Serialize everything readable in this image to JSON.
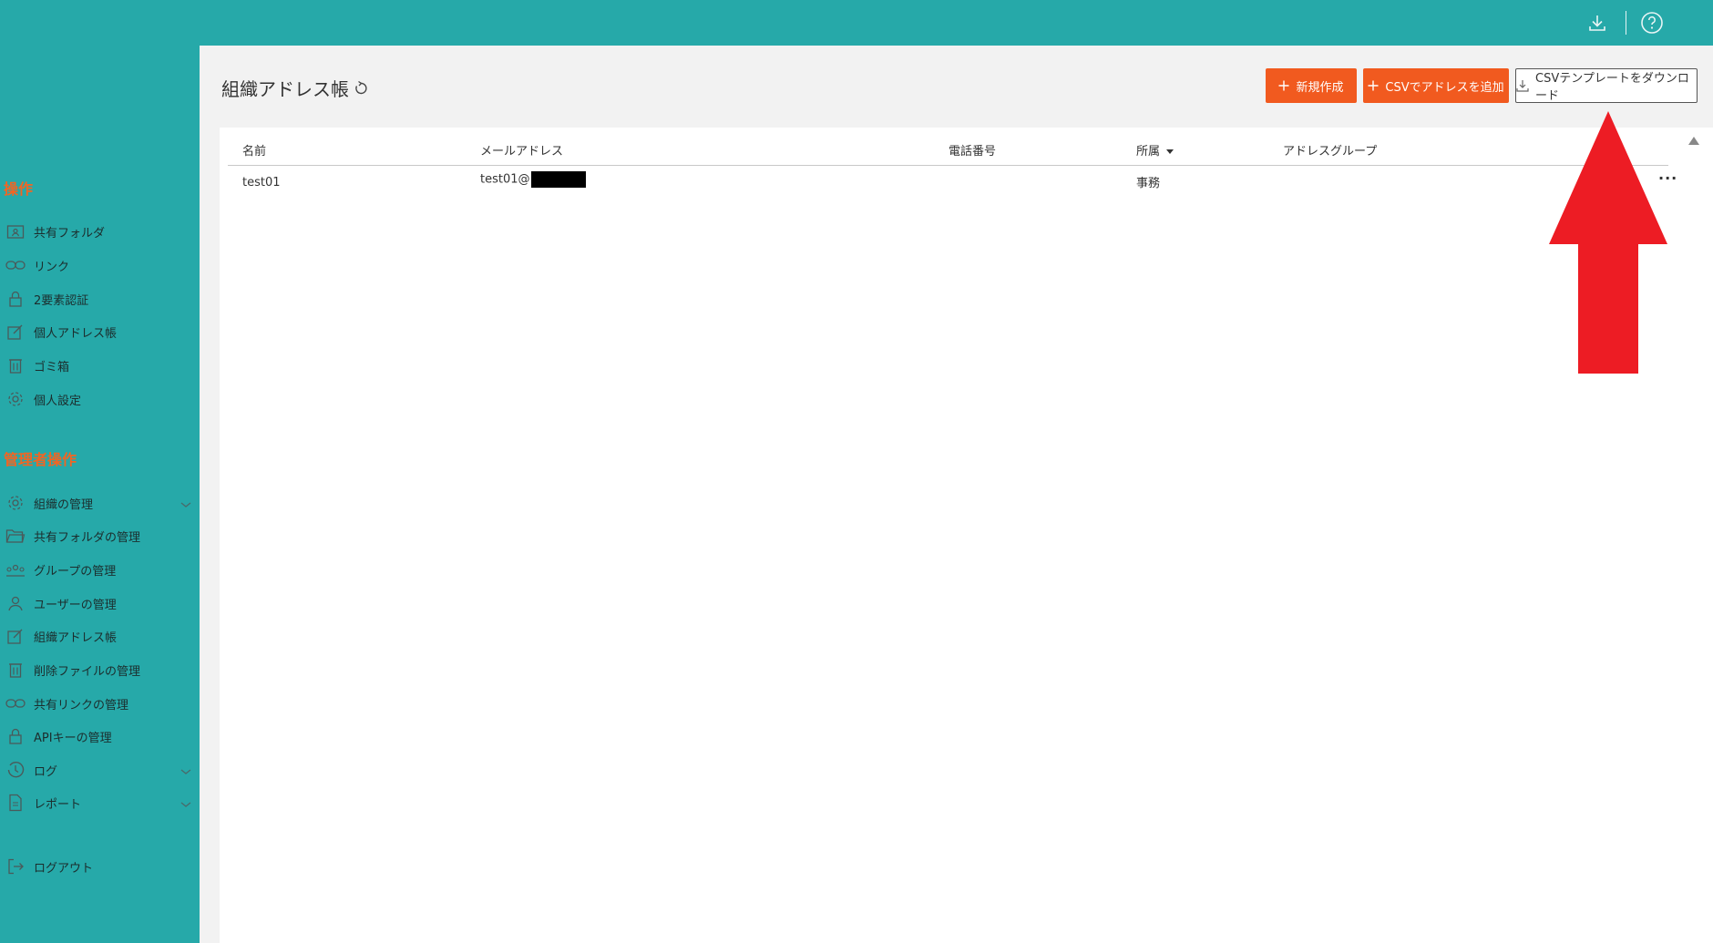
{
  "topbar": {
    "download_icon": "download-icon",
    "help_icon": "help-icon"
  },
  "sidebar": {
    "section_ops": "操作",
    "ops_items": [
      {
        "label": "共有フォルダ",
        "icon": "shared-folder-icon"
      },
      {
        "label": "リンク",
        "icon": "link-icon"
      },
      {
        "label": "2要素認証",
        "icon": "lock-icon"
      },
      {
        "label": "個人アドレス帳",
        "icon": "edit-icon"
      },
      {
        "label": "ゴミ箱",
        "icon": "trash-icon"
      },
      {
        "label": "個人設定",
        "icon": "gear-icon"
      }
    ],
    "section_admin": "管理者操作",
    "admin_items": [
      {
        "label": "組織の管理",
        "icon": "gear-icon"
      },
      {
        "label": "共有フォルダの管理",
        "icon": "folder-open-icon"
      },
      {
        "label": "グループの管理",
        "icon": "group-icon"
      },
      {
        "label": "ユーザーの管理",
        "icon": "user-icon"
      },
      {
        "label": "組織アドレス帳",
        "icon": "edit-icon"
      },
      {
        "label": "削除ファイルの管理",
        "icon": "trash-icon"
      },
      {
        "label": "共有リンクの管理",
        "icon": "link-icon"
      },
      {
        "label": "APIキーの管理",
        "icon": "lock-icon"
      },
      {
        "label": "ログ",
        "icon": "history-icon"
      },
      {
        "label": "レポート",
        "icon": "document-icon"
      }
    ],
    "logout": "ログアウト"
  },
  "main": {
    "title": "組織アドレス帳",
    "buttons": {
      "new": "新規作成",
      "csv_add": "CSVでアドレスを追加",
      "csv_template": "CSVテンプレートをダウンロード"
    },
    "table": {
      "headers": {
        "name": "名前",
        "email": "メールアドレス",
        "phone": "電話番号",
        "dept": "所属",
        "group": "アドレスグループ"
      },
      "rows": [
        {
          "name": "test01",
          "email": "test01@",
          "phone": "",
          "dept": "事務",
          "group": ""
        }
      ]
    }
  },
  "colors": {
    "brand_teal": "#26a9a9",
    "accent_orange": "#f15a1f",
    "annotation_red": "#ed1c24"
  }
}
